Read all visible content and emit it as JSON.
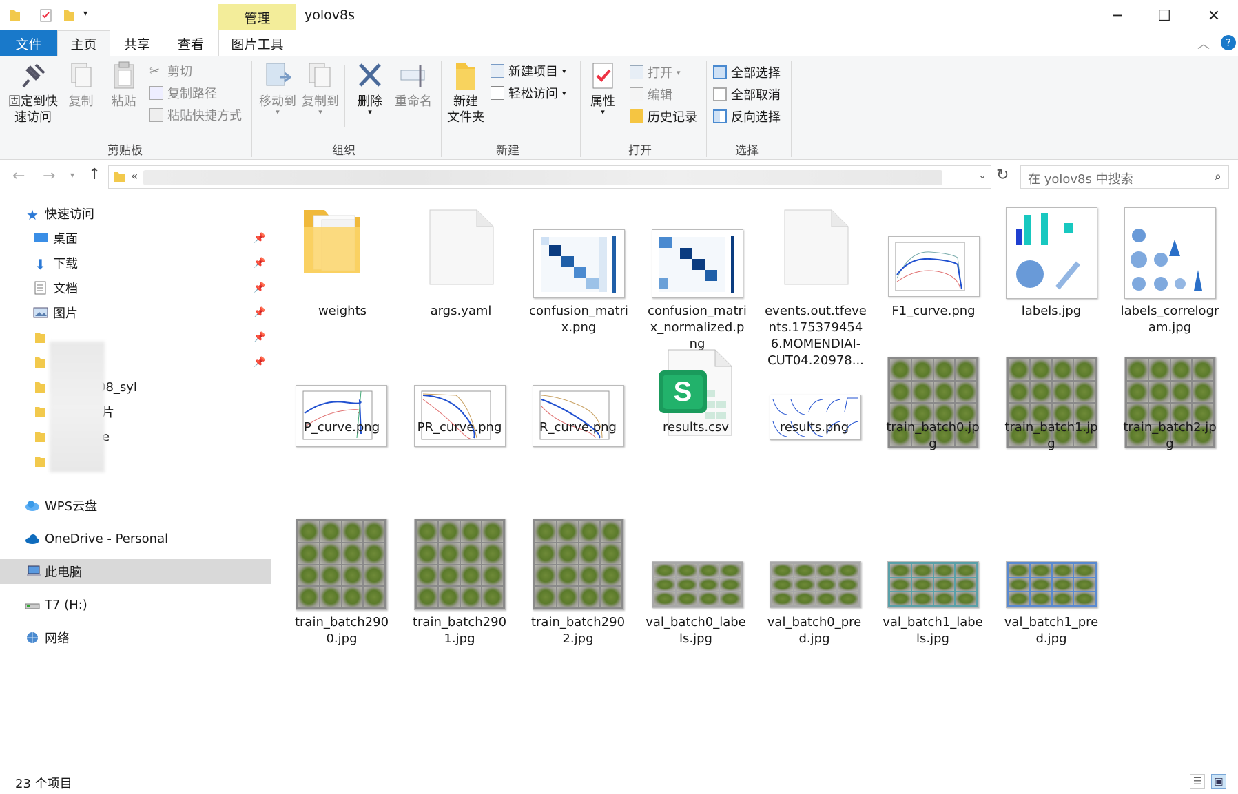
{
  "window": {
    "title": "yolov8s",
    "manage_tab": "管理",
    "minimize": "─",
    "maximize": "☐",
    "close": "✕"
  },
  "tabs": {
    "file": "文件",
    "home": "主页",
    "share": "共享",
    "view": "查看",
    "picture_tools": "图片工具"
  },
  "ribbon": {
    "clipboard": {
      "label": "剪贴板",
      "pin": "固定到快\n速访问",
      "copy": "复制",
      "paste": "粘贴",
      "cut": "剪切",
      "copy_path": "复制路径",
      "paste_shortcut": "粘贴快捷方式"
    },
    "organize": {
      "label": "组织",
      "move_to": "移动到",
      "copy_to": "复制到",
      "delete": "删除",
      "rename": "重命名"
    },
    "new": {
      "label": "新建",
      "new_folder": "新建\n文件夹",
      "new_item": "新建项目",
      "easy_access": "轻松访问"
    },
    "open": {
      "label": "打开",
      "properties": "属性",
      "open": "打开",
      "edit": "编辑",
      "history": "历史记录"
    },
    "select": {
      "label": "选择",
      "select_all": "全部选择",
      "select_none": "全部取消",
      "invert": "反向选择"
    }
  },
  "address": {
    "prefix": "«",
    "search_placeholder": "在 yolov8s 中搜索"
  },
  "sidebar": {
    "quick_access": "快速访问",
    "desktop": "桌面",
    "downloads": "下载",
    "documents": "文档",
    "pictures": "图片",
    "partial_1": "08_syl",
    "partial_2": "片",
    "partial_3": "e",
    "wps": "WPS云盘",
    "onedrive": "OneDrive - Personal",
    "this_pc": "此电脑",
    "t7": "T7 (H:)",
    "network": "网络"
  },
  "files": [
    {
      "name": "weights",
      "type": "folder"
    },
    {
      "name": "args.yaml",
      "type": "blank"
    },
    {
      "name": "confusion_matrix.png",
      "type": "matrix"
    },
    {
      "name": "confusion_matrix_normalized.png",
      "type": "matrix"
    },
    {
      "name": "events.out.tfevents.1753794546.MOMENDIAI-CUT04.20978...",
      "type": "blank"
    },
    {
      "name": "F1_curve.png",
      "type": "curve"
    },
    {
      "name": "labels.jpg",
      "type": "labels"
    },
    {
      "name": "labels_correlogram.jpg",
      "type": "correlogram"
    },
    {
      "name": "P_curve.png",
      "type": "curve"
    },
    {
      "name": "PR_curve.png",
      "type": "curve"
    },
    {
      "name": "R_curve.png",
      "type": "curve"
    },
    {
      "name": "results.csv",
      "type": "csv"
    },
    {
      "name": "results.png",
      "type": "results"
    },
    {
      "name": "train_batch0.jpg",
      "type": "batch"
    },
    {
      "name": "train_batch1.jpg",
      "type": "batch"
    },
    {
      "name": "train_batch2.jpg",
      "type": "batch"
    },
    {
      "name": "train_batch2900.jpg",
      "type": "batch"
    },
    {
      "name": "train_batch2901.jpg",
      "type": "batch"
    },
    {
      "name": "train_batch2902.jpg",
      "type": "batch"
    },
    {
      "name": "val_batch0_labels.jpg",
      "type": "val"
    },
    {
      "name": "val_batch0_pred.jpg",
      "type": "val"
    },
    {
      "name": "val_batch1_labels.jpg",
      "type": "val"
    },
    {
      "name": "val_batch1_pred.jpg",
      "type": "val"
    }
  ],
  "file_labels": {
    "f0": "weights",
    "f1": "args.yaml",
    "f2": "confusion_matri\nx.png",
    "f3": "confusion_matri\nx_normalized.p\nng",
    "f4": "events.out.tfeve\nnts.175379454\n6.MOMENDIAI-\nCUT04.20978...",
    "f5": "F1_curve.png",
    "f6": "labels.jpg",
    "f7": "labels_correlogr\nam.jpg",
    "f8": "P_curve.png",
    "f9": "PR_curve.png",
    "f10": "R_curve.png",
    "f11": "results.csv",
    "f12": "results.png",
    "f13": "train_batch0.jp\ng",
    "f14": "train_batch1.jp\ng",
    "f15": "train_batch2.jp\ng",
    "f16": "train_batch290\n0.jpg",
    "f17": "train_batch290\n1.jpg",
    "f18": "train_batch290\n2.jpg",
    "f19": "val_batch0_labe\nls.jpg",
    "f20": "val_batch0_pre\nd.jpg",
    "f21": "val_batch1_labe\nls.jpg",
    "f22": "val_batch1_pre\nd.jpg"
  },
  "status": {
    "count": "23 个项目"
  },
  "colors": {
    "file_tab": "#1979ca",
    "manage_tab": "#f3ed9a",
    "selection": "#d9d9d9"
  }
}
